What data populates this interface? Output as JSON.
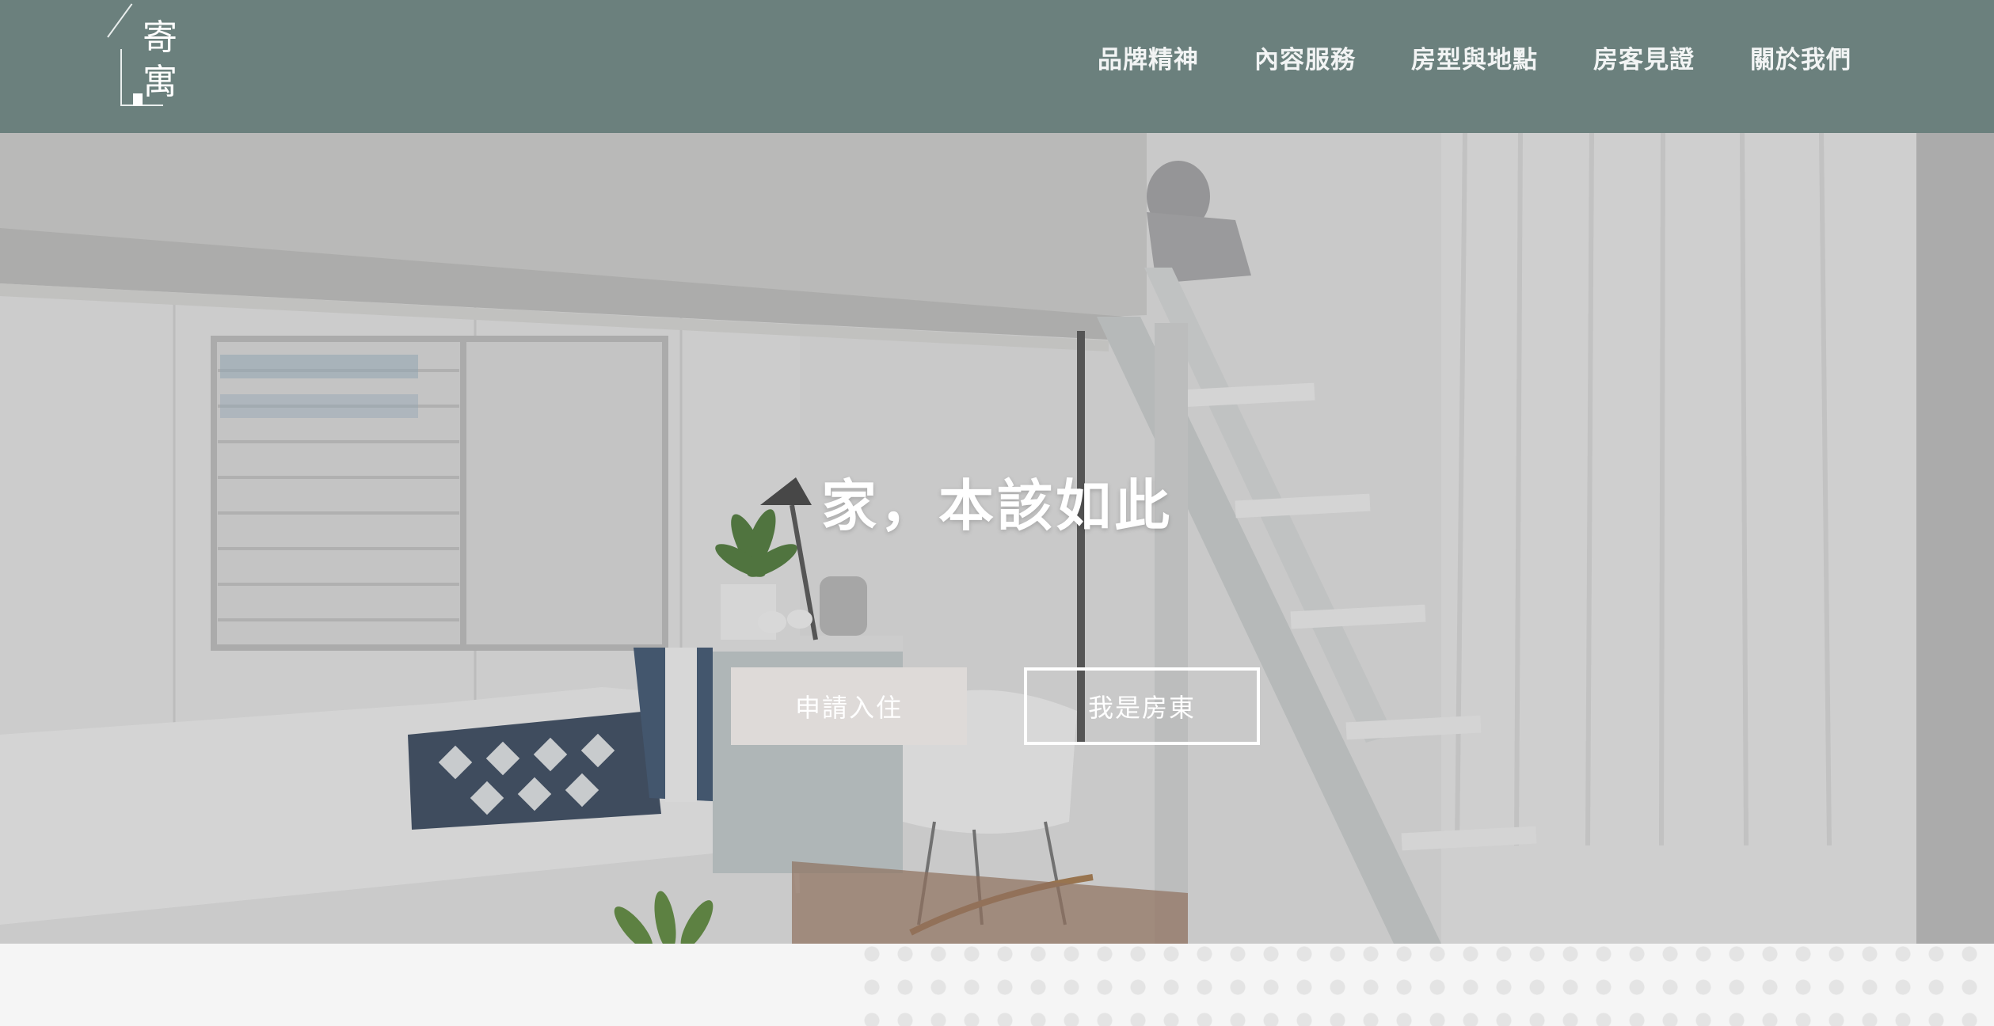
{
  "header": {
    "logo_chars": [
      "寄",
      "寓"
    ],
    "nav": [
      {
        "label": "品牌精神"
      },
      {
        "label": "內容服務"
      },
      {
        "label": "房型與地點"
      },
      {
        "label": "房客見證"
      },
      {
        "label": "關於我們"
      }
    ],
    "background_color": "#6b807d"
  },
  "hero": {
    "title": "家，本該如此",
    "buttons": {
      "apply": "申請入住",
      "owner": "我是房東"
    }
  }
}
